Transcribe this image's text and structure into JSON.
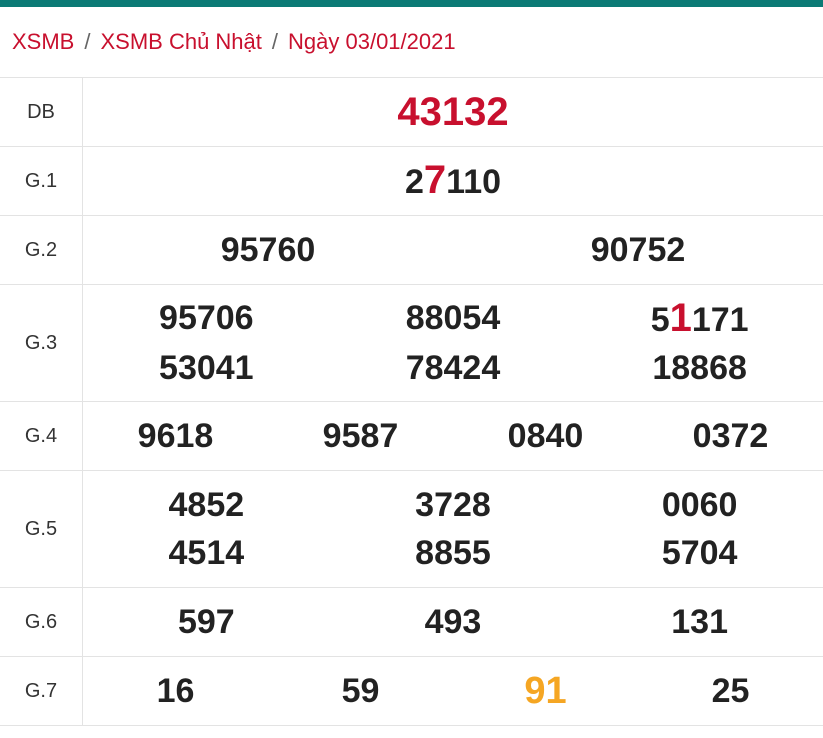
{
  "breadcrumb": [
    "XSMB",
    "XSMB Chủ Nhật",
    "Ngày 03/01/2021"
  ],
  "separator": "/",
  "colors": {
    "topbar": "#0b7a75",
    "accent": "#c8102e",
    "orange": "#f5a623"
  },
  "rows": [
    {
      "label": "DB",
      "numbers": [
        "43132"
      ]
    },
    {
      "label": "G.1",
      "numbers": [
        "27110"
      ]
    },
    {
      "label": "G.2",
      "numbers": [
        "95760",
        "90752"
      ]
    },
    {
      "label": "G.3",
      "numbers": [
        "95706",
        "88054",
        "51171",
        "53041",
        "78424",
        "18868"
      ]
    },
    {
      "label": "G.4",
      "numbers": [
        "9618",
        "9587",
        "0840",
        "0372"
      ]
    },
    {
      "label": "G.5",
      "numbers": [
        "4852",
        "3728",
        "0060",
        "4514",
        "8855",
        "5704"
      ]
    },
    {
      "label": "G.6",
      "numbers": [
        "597",
        "493",
        "131"
      ]
    },
    {
      "label": "G.7",
      "numbers": [
        "16",
        "59",
        "91",
        "25"
      ]
    }
  ],
  "highlights": {
    "g1": {
      "pre": "2",
      "hl": "7",
      "post": "110"
    },
    "g3_3": {
      "pre": "5",
      "hl": "1",
      "post": "171"
    }
  }
}
